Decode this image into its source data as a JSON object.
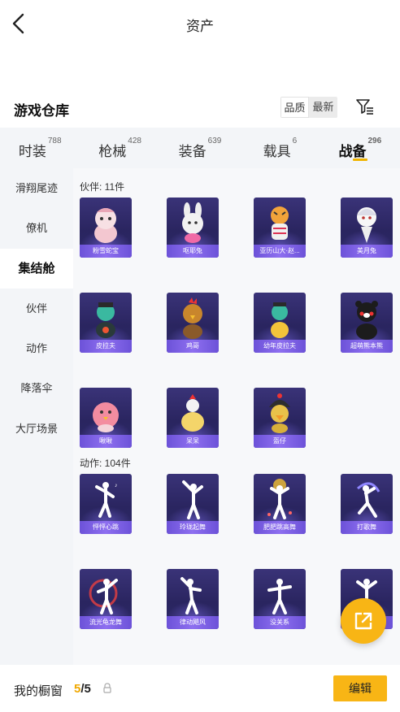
{
  "header": {
    "title": "资产"
  },
  "warehouse": {
    "title": "游戏仓库",
    "sort_options": [
      "品质",
      "最新"
    ]
  },
  "tabs": [
    {
      "label": "时装",
      "count": "788"
    },
    {
      "label": "枪械",
      "count": "428"
    },
    {
      "label": "装备",
      "count": "639"
    },
    {
      "label": "载具",
      "count": "6"
    },
    {
      "label": "战备",
      "count": "296",
      "active": true
    }
  ],
  "sidebar": {
    "items": [
      "滑翔尾迹",
      "僚机",
      "集结舱",
      "伙伴",
      "动作",
      "降落伞",
      "大厅场景"
    ],
    "active_index": 2
  },
  "groups": [
    {
      "label": "伙伴: 11件",
      "items": [
        "粉雪蛇宝",
        "呕耶兔",
        "亚历山大·赵...",
        "美月兔",
        "皮拉夫",
        "鸡哥",
        "幼年皮拉夫",
        "超萌熊本熊",
        "啾啾",
        "呆呆",
        "盔仔"
      ]
    },
    {
      "label": "动作: 104件",
      "items": [
        "怦怦心跳",
        "玲珑起舞",
        "肥肥跳高舞",
        "打歌舞",
        "流光龟龙舞",
        "律动飓风",
        "没关系",
        ""
      ]
    }
  ],
  "bottom_bar": {
    "showcase_label": "我的橱窗",
    "current": "5",
    "total": "/5",
    "edit_label": "编辑"
  },
  "colors": {
    "accent": "#f8b515",
    "card_bg": "#2a2560",
    "card_caption": "#8e6ff0",
    "panel_bg": "#f3f5f8"
  },
  "icons": {
    "back": "chevron-left-icon",
    "filter": "filter-icon",
    "share": "share-icon",
    "lock": "lock-icon"
  }
}
